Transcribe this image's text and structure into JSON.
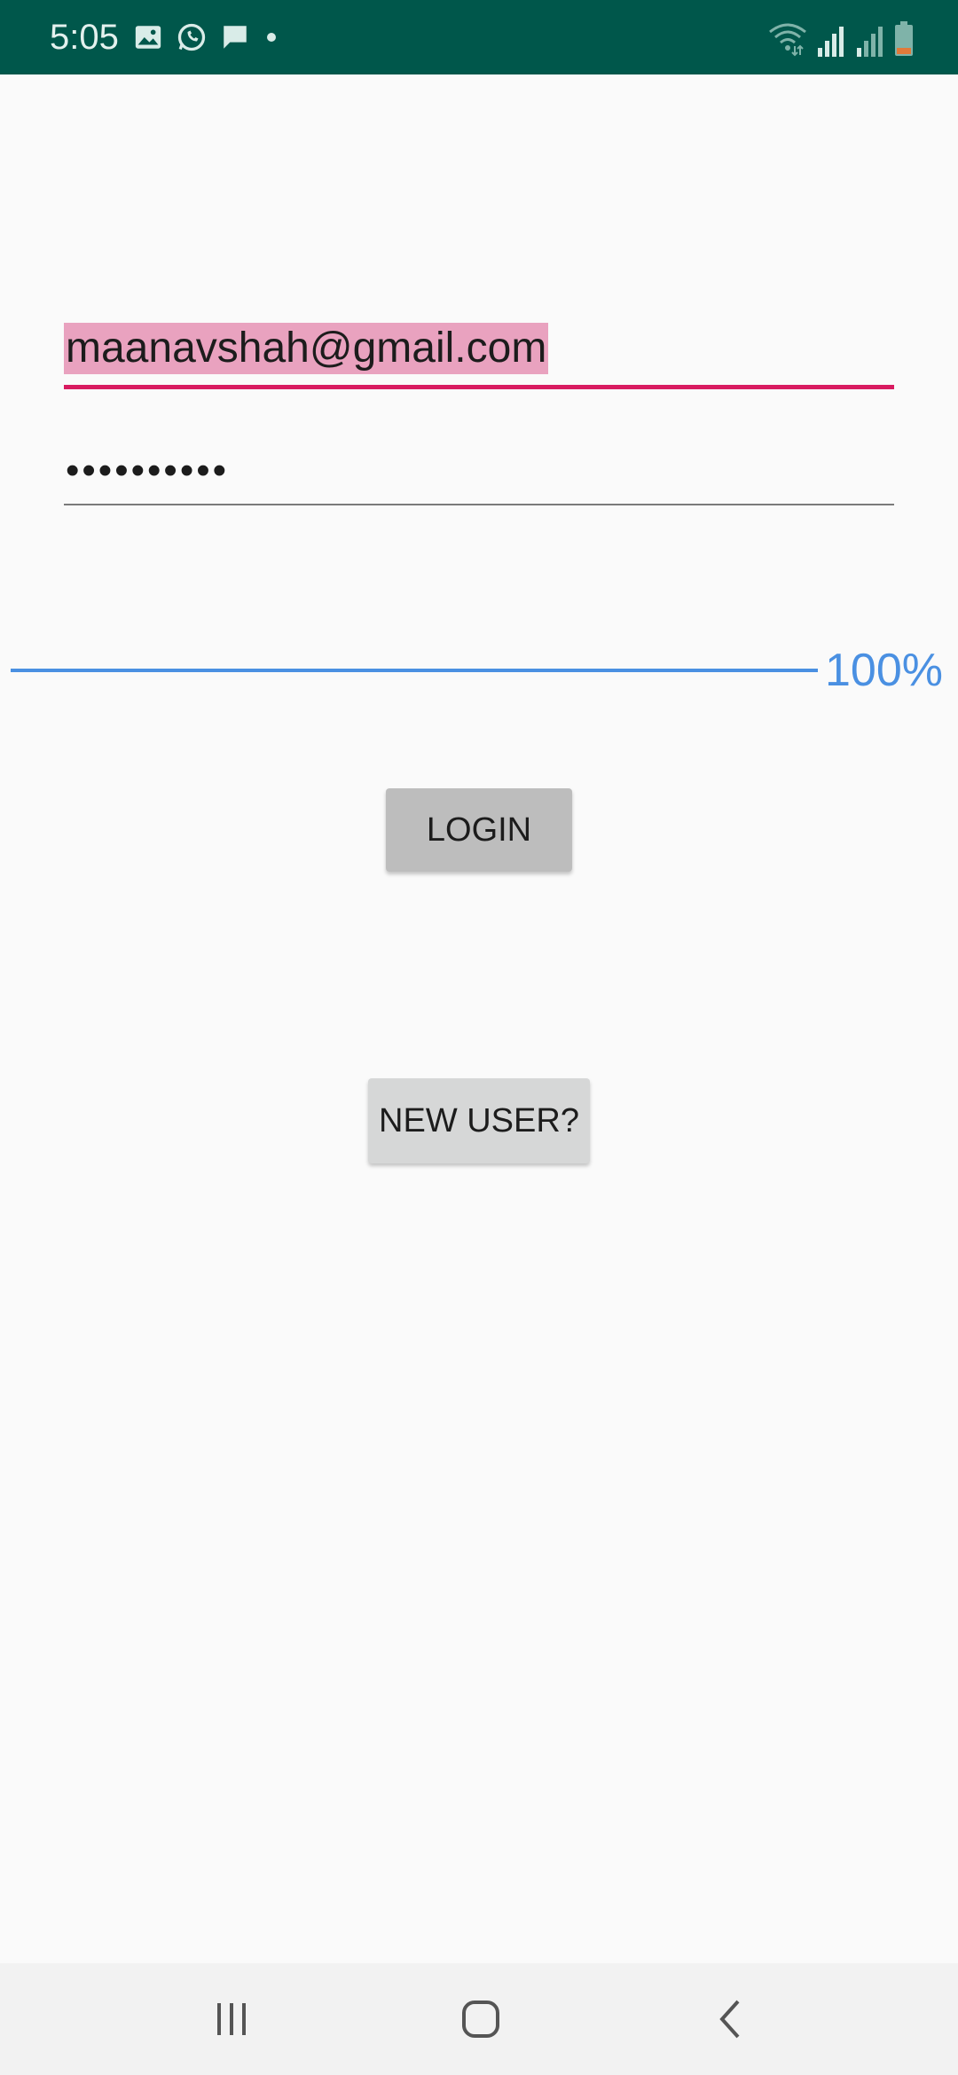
{
  "status_bar": {
    "time": "5:05",
    "left_icons": [
      "image-icon",
      "whatsapp-icon",
      "message-icon",
      "dot-icon"
    ],
    "right_icons": [
      "wifi-icon",
      "signal-icon",
      "signal-weak-icon",
      "battery-low-icon"
    ],
    "background_color": "#00574b"
  },
  "login_form": {
    "email": {
      "value": "maanavshah@gmail.com",
      "underline_color": "#d81b60",
      "selection_color": "#e9a2bf"
    },
    "password": {
      "masked_value": "••••••••••"
    },
    "progress": {
      "value_percent": 100,
      "label": "100%",
      "color": "#4a90e2"
    },
    "login_button": {
      "label": "LOGIN"
    },
    "new_user_button": {
      "label": "NEW USER?"
    }
  },
  "nav_bar": {
    "items": [
      "recent-apps-icon",
      "home-icon",
      "back-icon"
    ]
  }
}
